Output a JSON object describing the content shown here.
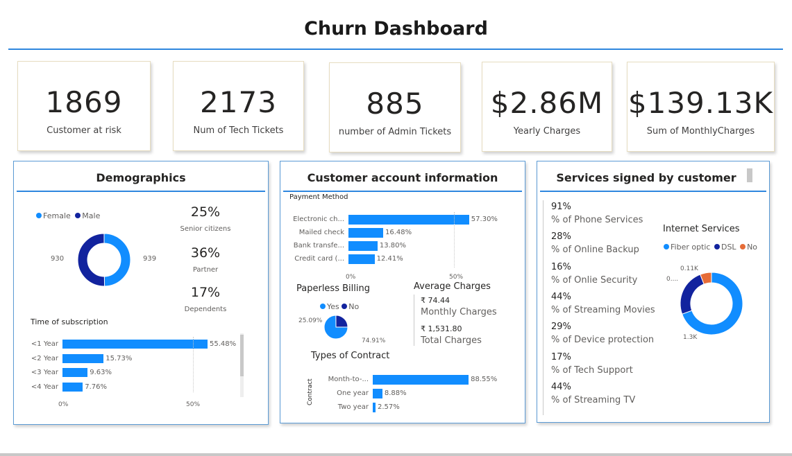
{
  "title": "Churn Dashboard",
  "colors": {
    "primary": "#118dff",
    "dark": "#12239e",
    "accent": "#e66c37",
    "rule": "#2e86de"
  },
  "kpis": [
    {
      "value": "1869",
      "label": "Customer at risk"
    },
    {
      "value": "2173",
      "label": "Num of Tech Tickets"
    },
    {
      "value": "885",
      "label": "number of Admin Tickets"
    },
    {
      "value": "$2.86M",
      "label": "Yearly Charges"
    },
    {
      "value": "$139.13K",
      "label": "Sum of MonthlyCharges"
    }
  ],
  "demographics": {
    "title": "Demographics",
    "legend": [
      "Female",
      "Male"
    ],
    "female_count": "930",
    "male_count": "939",
    "stats": [
      {
        "value": "25%",
        "label": "Senior citizens"
      },
      {
        "value": "36%",
        "label": "Partner"
      },
      {
        "value": "17%",
        "label": "Dependents"
      }
    ],
    "subscription_title": "Time of subscription",
    "axis_labels": [
      "0%",
      "50%"
    ]
  },
  "account": {
    "title": "Customer account information",
    "payment_title": "Payment Method",
    "payment_axis": [
      "0%",
      "50%"
    ],
    "paperless_title": "Paperless Billing",
    "paperless_legend": [
      "Yes",
      "No"
    ],
    "paperless_labels": {
      "no": "25.09%",
      "yes": "74.91%"
    },
    "avg_title": "Average Charges",
    "avg_items": [
      {
        "value": "₹ 74.44",
        "label": "Monthly Charges"
      },
      {
        "value": "₹ 1,531.80",
        "label": "Total Charges"
      }
    ],
    "contract_title": "Types of Contract",
    "contract_axis_title": "Contract"
  },
  "services": {
    "title": "Services signed by customer",
    "items": [
      {
        "pct": "91%",
        "label": "% of Phone Services"
      },
      {
        "pct": "28%",
        "label": "% of Online Backup"
      },
      {
        "pct": "16%",
        "label": "% of Onlie Security"
      },
      {
        "pct": "44%",
        "label": "% of Streaming Movies"
      },
      {
        "pct": "29%",
        "label": "% of Device protection"
      },
      {
        "pct": "17%",
        "label": "% of Tech Support"
      },
      {
        "pct": "44%",
        "label": "% of Streaming TV"
      }
    ],
    "internet_title": "Internet Services",
    "internet_legend": [
      "Fiber optic",
      "DSL",
      "No"
    ],
    "internet_labels": {
      "no": "0.11K",
      "dsl": "0....",
      "fiber": "1.3K"
    }
  },
  "chart_data": [
    {
      "type": "pie",
      "name": "gender-donut",
      "categories": [
        "Female",
        "Male"
      ],
      "values": [
        930,
        939
      ]
    },
    {
      "type": "bar",
      "orientation": "horizontal",
      "name": "subscription",
      "title": "Time of subscription",
      "categories": [
        "<1 Year",
        "<2 Year",
        "<3 Year",
        "<4 Year"
      ],
      "values": [
        55.48,
        15.73,
        9.63,
        7.76
      ],
      "value_labels": [
        "55.48%",
        "15.73%",
        "9.63%",
        "7.76%"
      ],
      "xlim": [
        0,
        60
      ]
    },
    {
      "type": "bar",
      "orientation": "horizontal",
      "name": "payment",
      "title": "Payment Method",
      "categories": [
        "Electronic ch...",
        "Mailed check",
        "Bank transfe...",
        "Credit card (..."
      ],
      "values": [
        57.3,
        16.48,
        13.8,
        12.41
      ],
      "value_labels": [
        "57.30%",
        "16.48%",
        "13.80%",
        "12.41%"
      ],
      "xlim": [
        0,
        60
      ]
    },
    {
      "type": "pie",
      "name": "paperless",
      "categories": [
        "Yes",
        "No"
      ],
      "values": [
        74.91,
        25.09
      ]
    },
    {
      "type": "bar",
      "orientation": "horizontal",
      "name": "contract",
      "title": "Types of Contract",
      "categories": [
        "Month-to-...",
        "One year",
        "Two year"
      ],
      "values": [
        88.55,
        8.88,
        2.57
      ],
      "value_labels": [
        "88.55%",
        "8.88%",
        "2.57%"
      ],
      "xlim": [
        0,
        100
      ]
    },
    {
      "type": "pie",
      "name": "internet",
      "title": "Internet Services",
      "categories": [
        "Fiber optic",
        "DSL",
        "No"
      ],
      "values": [
        1300,
        460,
        110
      ]
    }
  ]
}
